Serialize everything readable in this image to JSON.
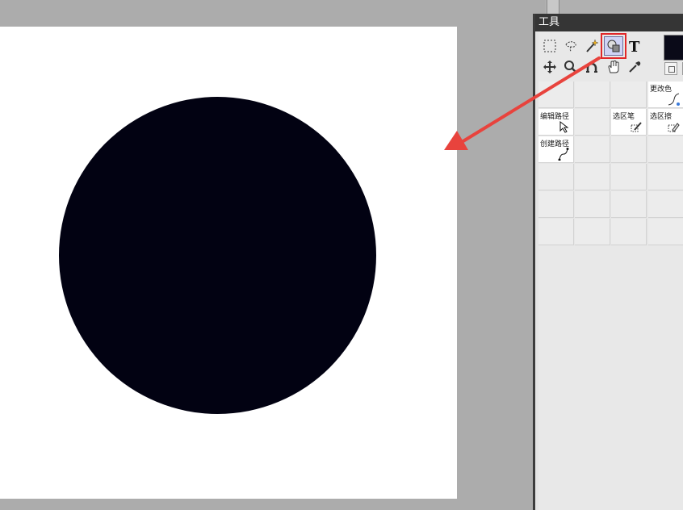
{
  "panel": {
    "title": "工具"
  },
  "toolbar_icons": [
    "rectangle-select-icon",
    "lasso-icon",
    "magic-wand-icon",
    "shape-tool-icon",
    "text-tool-icon",
    "move-icon",
    "zoom-icon",
    "bend-icon",
    "hand-icon",
    "eyedropper-icon"
  ],
  "grid_items": {
    "change_color": "更改色",
    "edit_path": "编辑路径",
    "selection_pen": "选区笔",
    "selection_eraser": "选区擦",
    "create_path": "创建路径"
  },
  "colors": {
    "shape_fill": "#020212",
    "highlight": "#e0272a",
    "arrow": "#e8433d"
  }
}
